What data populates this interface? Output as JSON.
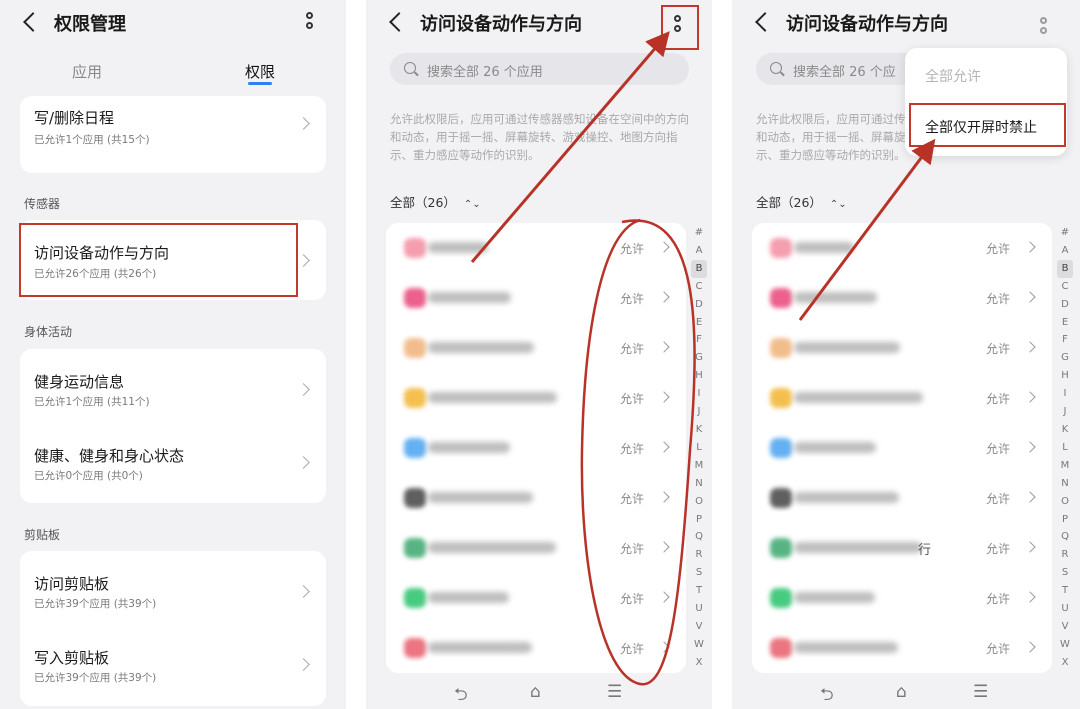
{
  "p1": {
    "title": "权限管理",
    "tabs": [
      "应用",
      "权限"
    ],
    "top_item": {
      "title": "写/删除日程",
      "sub": "已允许1个应用 (共15个)"
    },
    "sections": [
      {
        "label": "传感器",
        "items": [
          {
            "title": "访问设备动作与方向",
            "sub": "已允许26个应用 (共26个)"
          }
        ]
      },
      {
        "label": "身体活动",
        "items": [
          {
            "title": "健身运动信息",
            "sub": "已允许1个应用 (共11个)"
          },
          {
            "title": "健康、健身和身心状态",
            "sub": "已允许0个应用 (共0个)"
          }
        ]
      },
      {
        "label": "剪贴板",
        "items": [
          {
            "title": "访问剪贴板",
            "sub": "已允许39个应用 (共39个)"
          },
          {
            "title": "写入剪贴板",
            "sub": "已允许39个应用 (共39个)"
          }
        ]
      }
    ]
  },
  "detail": {
    "title": "访问设备动作与方向",
    "search_placeholder": "搜索全部 26 个应用",
    "search_placeholder_short": "搜索全部 26 个应",
    "description": "允许此权限后，应用可通过传感器感知设备在空间中的方向和动态，用于摇一摇、屏幕旋转、游戏操控、地图方向指示、重力感应等动作的识别。",
    "filter": "全部（26）",
    "allow_label": "允许",
    "index_letters": [
      "#",
      "A",
      "B",
      "C",
      "D",
      "E",
      "F",
      "G",
      "H",
      "I",
      "J",
      "K",
      "L",
      "M",
      "N",
      "O",
      "P",
      "Q",
      "R",
      "S",
      "T",
      "U",
      "V",
      "W",
      "X"
    ],
    "selected_letter": "B",
    "app_colors": [
      "#f28da0",
      "#e8457a",
      "#f0b27a",
      "#f2b531",
      "#4aa3f0",
      "#444444",
      "#3aa76d",
      "#27c26a",
      "#e85d6b"
    ],
    "p3_fragment": "行"
  },
  "menu": {
    "items": [
      "全部允许",
      "全部仅开屏时禁止"
    ]
  },
  "navbar": {
    "back": "⮌",
    "home": "⌂",
    "menu": "☰"
  },
  "annotation_color": "#b83227"
}
